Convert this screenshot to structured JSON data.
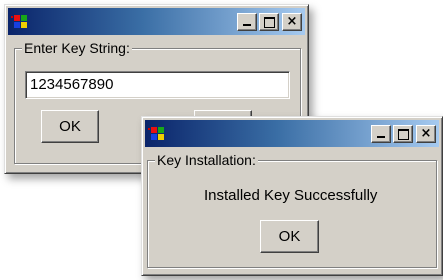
{
  "colors": {
    "face": "#d4d0c8",
    "titlebar_start": "#0a246a",
    "titlebar_end": "#a6caf0"
  },
  "key_entry_window": {
    "title": "",
    "icon": "windows-flag-icon",
    "title_buttons": {
      "minimize": "minimize-icon",
      "maximize": "maximize-icon",
      "close": "×"
    },
    "group_label": "Enter Key String:",
    "input_value": "1234567890",
    "ok_label": "OK"
  },
  "installation_window": {
    "title": "",
    "icon": "windows-flag-icon",
    "title_buttons": {
      "minimize": "minimize-icon",
      "maximize": "maximize-icon",
      "close": "×"
    },
    "group_label": "Key Installation:",
    "message": "Installed Key Successfully",
    "ok_label": "OK"
  }
}
